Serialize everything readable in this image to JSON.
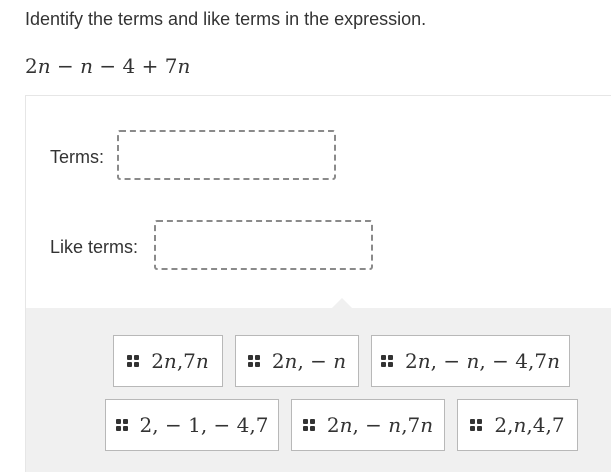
{
  "question": {
    "prompt": "Identify the terms and like terms in the expression.",
    "expression": "2n − n − 4 + 7n"
  },
  "drop_zones": [
    {
      "label": "Terms:"
    },
    {
      "label": "Like terms:"
    }
  ],
  "choices": [
    {
      "text": "2n,7n"
    },
    {
      "text": "2n, − n"
    },
    {
      "text": "2n, − n, − 4,7n"
    },
    {
      "text": "2, − 1, − 4,7"
    },
    {
      "text": "2n, − n,7n"
    },
    {
      "text": "2,n,4,7"
    }
  ],
  "icons": {
    "drag_handle": "drag-handle-icon"
  }
}
